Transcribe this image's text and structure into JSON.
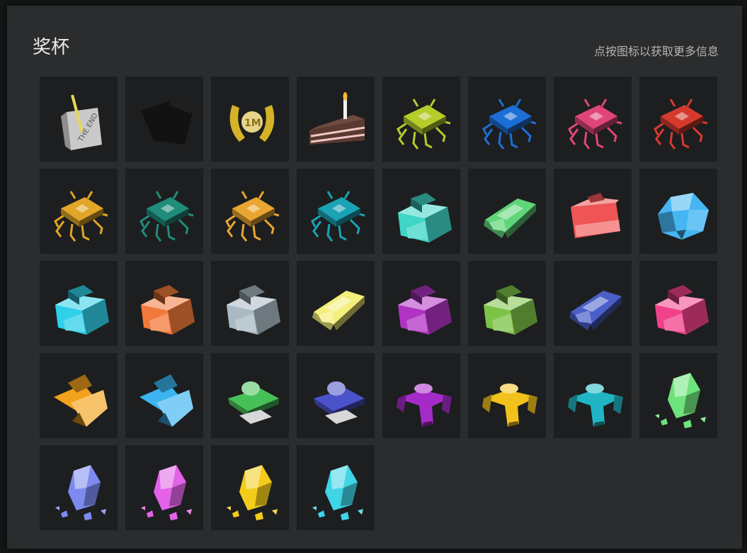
{
  "header": {
    "title": "奖杯",
    "hint": "点按图标以获取更多信息"
  },
  "trophies": [
    {
      "icon": "the-end-scroll-icon",
      "kind": "scroll",
      "color": "#b9b9b9"
    },
    {
      "icon": "locked-trophy-icon",
      "kind": "locked",
      "color": "#121212"
    },
    {
      "icon": "one-million-laurel-icon",
      "kind": "laurel",
      "color": "#d4b328"
    },
    {
      "icon": "birthday-cake-icon",
      "kind": "cake",
      "color": "#5a3a30"
    },
    {
      "icon": "xp-chip-lime-icon",
      "kind": "chip",
      "color": "#b5cc2b"
    },
    {
      "icon": "chip-blue-icon",
      "kind": "chip",
      "color": "#1c6fd6"
    },
    {
      "icon": "chip-pink-icon",
      "kind": "chip",
      "color": "#e0457a"
    },
    {
      "icon": "chip-red-icon",
      "kind": "chip",
      "color": "#d63a2e"
    },
    {
      "icon": "chip-gold-icon",
      "kind": "chip",
      "color": "#e0a625"
    },
    {
      "icon": "chip-teal-icon",
      "kind": "chip",
      "color": "#1f8c7c"
    },
    {
      "icon": "chip-orange-icon",
      "kind": "chip",
      "color": "#e9a630"
    },
    {
      "icon": "xp-chip-cyan-icon",
      "kind": "chip",
      "color": "#1aa3b5"
    },
    {
      "icon": "tank-teal-icon",
      "kind": "tank",
      "color": "#3fd6c8"
    },
    {
      "icon": "tank-green-icon",
      "kind": "slab",
      "color": "#5fd67a"
    },
    {
      "icon": "tank-red-icon",
      "kind": "box",
      "color": "#ef5555"
    },
    {
      "icon": "crystal-blue-icon",
      "kind": "crystal",
      "color": "#45b6f2"
    },
    {
      "icon": "tank-cyan-icon",
      "kind": "tank",
      "color": "#2fd0ea"
    },
    {
      "icon": "tank-orange-icon",
      "kind": "tank",
      "color": "#f2793a"
    },
    {
      "icon": "tank-gray-icon",
      "kind": "tank",
      "color": "#a9bac4"
    },
    {
      "icon": "tank-yellow-icon",
      "kind": "slab",
      "color": "#f4ee7a"
    },
    {
      "icon": "tank-purple-icon",
      "kind": "tank",
      "color": "#b033c4"
    },
    {
      "icon": "tank-olive-icon",
      "kind": "tank",
      "color": "#7bc247"
    },
    {
      "icon": "tank-navy-icon",
      "kind": "slab",
      "color": "#4a5fc9"
    },
    {
      "icon": "tank-magenta-icon",
      "kind": "tank",
      "color": "#f0428a"
    },
    {
      "icon": "wreck-orange-icon",
      "kind": "wreck",
      "color": "#f2a21c"
    },
    {
      "icon": "wreck-sky-icon",
      "kind": "wreck",
      "color": "#3bb4ef"
    },
    {
      "icon": "hover-green-icon",
      "kind": "hover",
      "color": "#48c058"
    },
    {
      "icon": "hover-indigo-icon",
      "kind": "hover",
      "color": "#4a53c9"
    },
    {
      "icon": "walker-purple-icon",
      "kind": "walker",
      "color": "#a52bc9"
    },
    {
      "icon": "walker-gold-icon",
      "kind": "walker",
      "color": "#f2c21c"
    },
    {
      "icon": "walker-teal-icon",
      "kind": "walker",
      "color": "#20b5c5"
    },
    {
      "icon": "shard-green-icon",
      "kind": "shard",
      "color": "#6ee37c"
    },
    {
      "icon": "shard-periwinkle-icon",
      "kind": "shard",
      "color": "#7d8bf0"
    },
    {
      "icon": "shard-pink-icon",
      "kind": "shard",
      "color": "#e262e8"
    },
    {
      "icon": "shard-yellow-icon",
      "kind": "shard",
      "color": "#f4cc1a"
    },
    {
      "icon": "shard-cyan-icon",
      "kind": "shard",
      "color": "#3fd4e6"
    }
  ]
}
